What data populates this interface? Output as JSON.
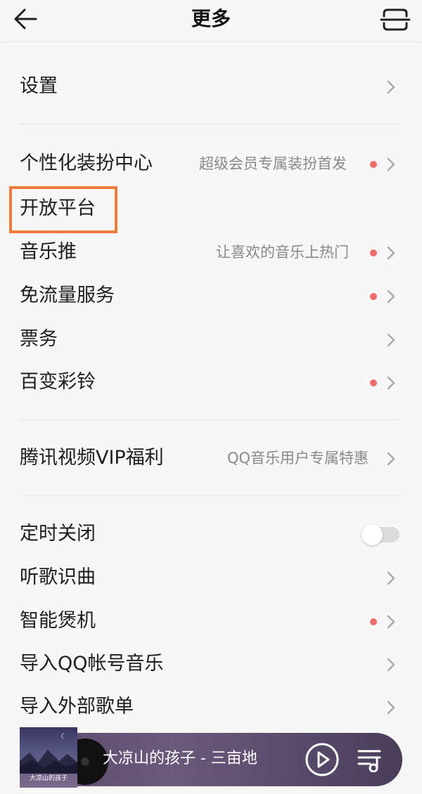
{
  "header": {
    "back_icon": "arrow-left-icon",
    "title": "更多",
    "scan_icon": "scan-icon"
  },
  "section1": {
    "settings": {
      "label": "设置"
    }
  },
  "section2": {
    "items": [
      {
        "label": "个性化装扮中心",
        "sub": "超级会员专属装扮首发",
        "dot": true
      },
      {
        "label": "开放平台",
        "sub": "",
        "dot": false
      },
      {
        "label": "音乐推",
        "sub": "让喜欢的音乐上热门",
        "dot": true
      },
      {
        "label": "免流量服务",
        "sub": "",
        "dot": true
      },
      {
        "label": "票务",
        "sub": "",
        "dot": false
      },
      {
        "label": "百变彩铃",
        "sub": "",
        "dot": true
      }
    ]
  },
  "section3": {
    "items": [
      {
        "label": "腾讯视频VIP福利",
        "sub": "QQ音乐用户专属特惠"
      }
    ]
  },
  "section4": {
    "items": [
      {
        "label": "定时关闭",
        "toggle_on": false
      },
      {
        "label": "听歌识曲"
      },
      {
        "label": "智能煲机",
        "dot": true
      },
      {
        "label": "导入QQ帐号音乐"
      },
      {
        "label": "导入外部歌单"
      }
    ]
  },
  "player": {
    "cover_text": "大凉山的孩子",
    "song": "大凉山的孩子 - 三亩地",
    "play_icon": "play-icon",
    "queue_icon": "playlist-icon"
  },
  "colors": {
    "red_dot": "#f06b6b",
    "highlight_border": "#f07a3c",
    "player_bg": "#5c4a6d"
  }
}
